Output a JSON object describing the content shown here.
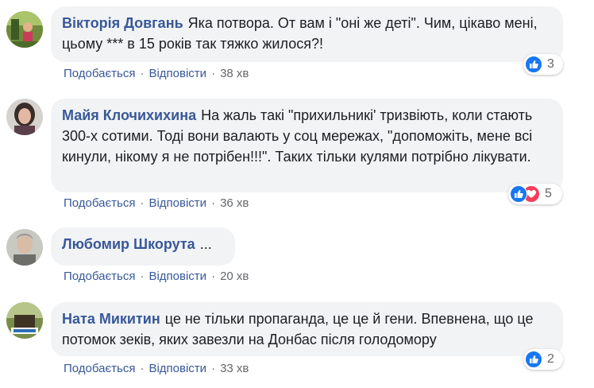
{
  "comments": [
    {
      "author": "Вікторія Довгань",
      "text": "Яка потвора. От вам і \"оні же деті\". Чим, цікаво мені, цьому *** в 15 років так тяжко жилося?!",
      "reaction_count": "3",
      "reactions": [
        "like"
      ],
      "actions": {
        "like": "Подобається",
        "reply": "Відповісти",
        "time": "38 хв"
      }
    },
    {
      "author": "Майя Клочихихина",
      "text": "На жаль такі \"прихильникі' тризвіють, коли стають 300-х сотими. Тоді вони валають у соц мережах, \"допоможіть, мене всі кинули, нікому я не потрібен!!!\". Таких тільки кулями потрібно лікувати.",
      "reaction_count": "5",
      "reactions": [
        "like",
        "love"
      ],
      "actions": {
        "like": "Подобається",
        "reply": "Відповісти",
        "time": "36 хв"
      }
    },
    {
      "author": "Любомир Шкорута",
      "text": "...",
      "actions": {
        "like": "Подобається",
        "reply": "Відповісти",
        "time": "20 хв"
      }
    },
    {
      "author": "Ната Микитин",
      "text": "це не тільки пропаганда, це це й гени. Впевнена, що це потомок зеків, яких завезли на Донбас після голодомору",
      "reaction_count": "2",
      "reactions": [
        "like"
      ],
      "actions": {
        "like": "Подобається",
        "reply": "Відповісти",
        "time": "33 хв"
      }
    }
  ],
  "separator": "·",
  "colors": {
    "author_link": "#385898",
    "bubble_bg": "#f2f3f5",
    "like_blue": "#1877f2",
    "love_red": "#f33e58",
    "meta_gray": "#65676b"
  }
}
